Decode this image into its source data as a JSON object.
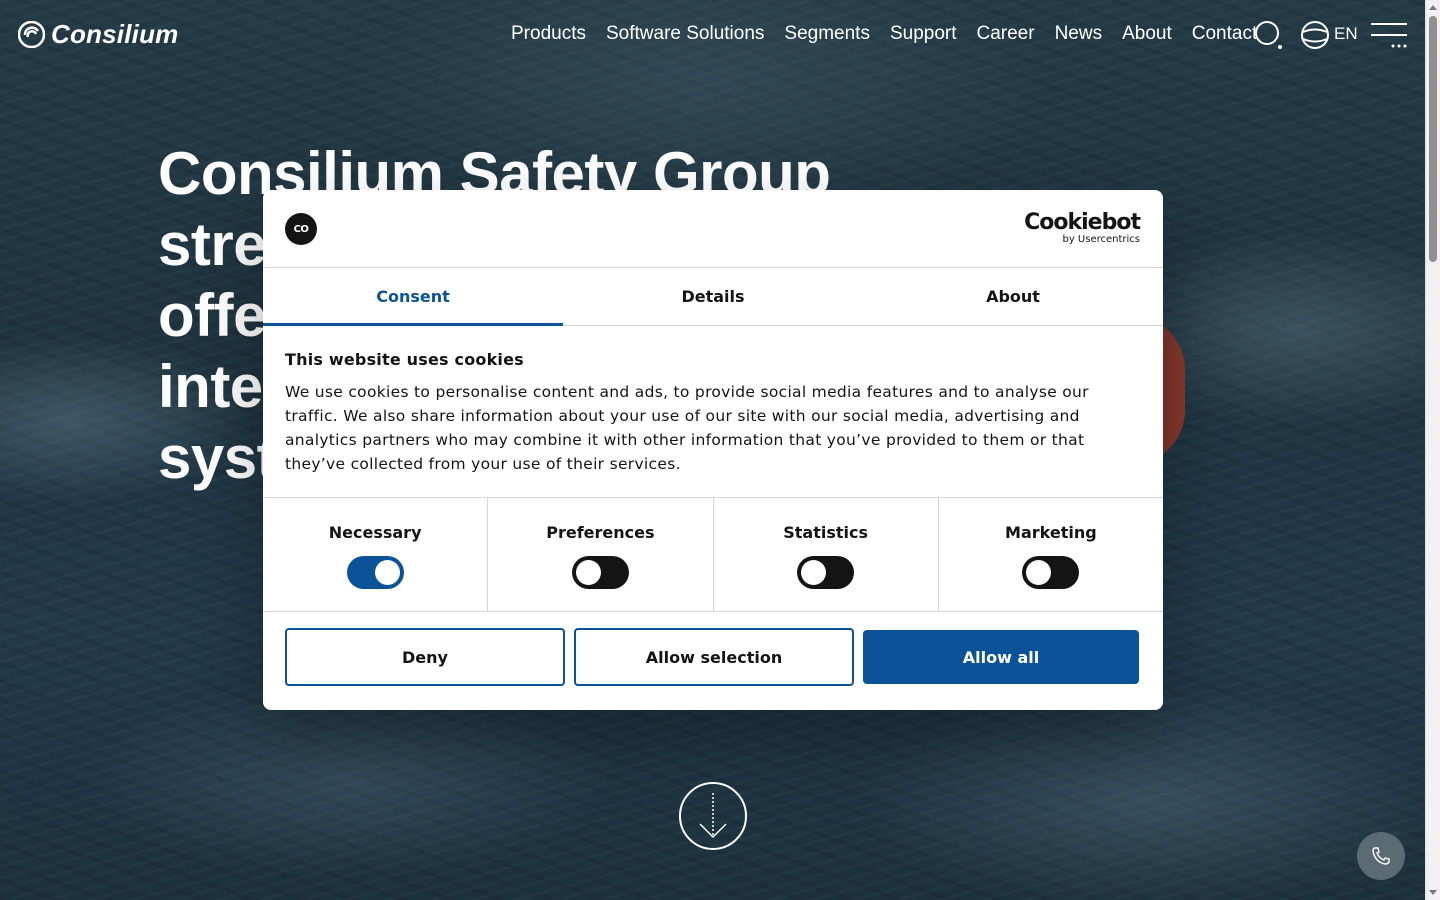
{
  "header": {
    "logo_text": "Consilium",
    "nav": [
      "Products",
      "Software Solutions",
      "Segments",
      "Support",
      "Career",
      "News",
      "About",
      "Contact"
    ],
    "language": "EN"
  },
  "hero": {
    "lines": [
      "Consilium Safety Group",
      "stren",
      "offer",
      "integ",
      "syste"
    ]
  },
  "cookie_dialog": {
    "badge": "CO",
    "brand_name": "Cookiebot",
    "brand_sub": "by Usercentrics",
    "tabs": [
      {
        "label": "Consent",
        "active": true
      },
      {
        "label": "Details",
        "active": false
      },
      {
        "label": "About",
        "active": false
      }
    ],
    "heading": "This website uses cookies",
    "text": "We use cookies to personalise content and ads, to provide social media features and to analyse our traffic. We also share information about your use of our site with our social media, advertising and analytics partners who may combine it with other information that you’ve provided to them or that they’ve collected from your use of their services.",
    "categories": [
      {
        "label": "Necessary",
        "on": true
      },
      {
        "label": "Preferences",
        "on": false
      },
      {
        "label": "Statistics",
        "on": false
      },
      {
        "label": "Marketing",
        "on": false
      }
    ],
    "buttons": {
      "deny": "Deny",
      "allow_selection": "Allow selection",
      "allow_all": "Allow all"
    }
  },
  "colors": {
    "accent": "#0b5298",
    "ocean": "#1f3440"
  }
}
